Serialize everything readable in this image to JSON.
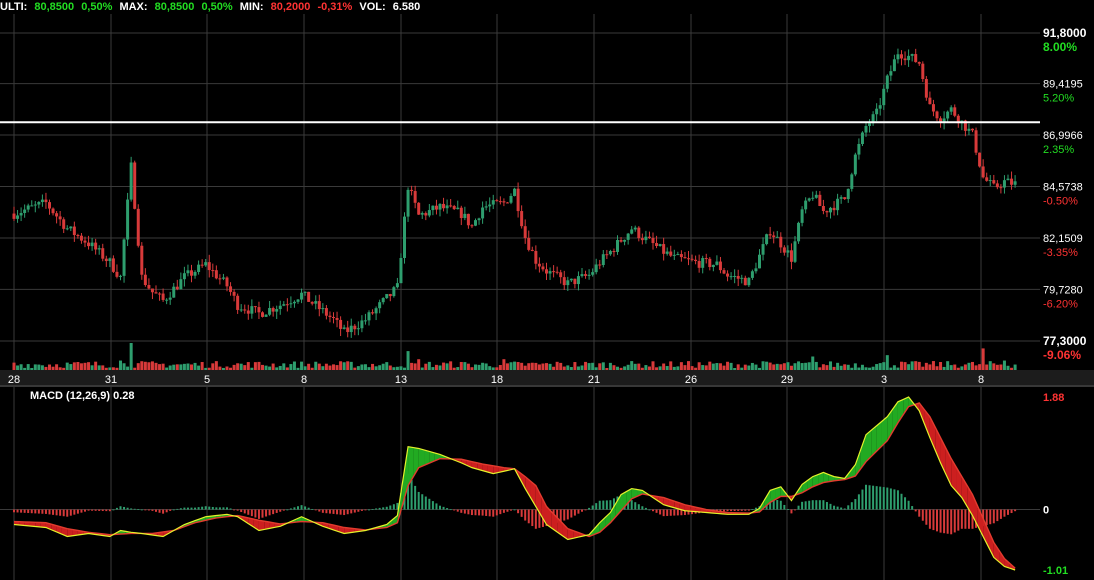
{
  "header": {
    "ulti_label": "ULTI:",
    "ulti_value": "80,8500",
    "ulti_pct": "0,50%",
    "max_label": "MAX:",
    "max_value": "80,8500",
    "max_pct": "0,50%",
    "min_label": "MIN:",
    "min_value": "80,2000",
    "min_pct": "-0,31%",
    "vol_label": "VOL:",
    "vol_value": "6.580"
  },
  "colors": {
    "up": "#2e9e6e",
    "down": "#d83a3a",
    "pos_text": "#22dd22",
    "neg_text": "#ff3333",
    "grid": "#3a3a3a",
    "background": "#000000"
  },
  "chart_data": [
    {
      "type": "candlestick",
      "panel": "price",
      "ylim": [
        77.3,
        91.8
      ],
      "price_ticks": [
        {
          "label": "91,8000",
          "value": 91.8
        },
        {
          "label": "89,4195",
          "value": 89.4195
        },
        {
          "label": "86,9966",
          "value": 86.9966
        },
        {
          "label": "84,5738",
          "value": 84.5738
        },
        {
          "label": "82,1509",
          "value": 82.1509
        },
        {
          "label": "79,7280",
          "value": 79.728
        },
        {
          "label": "77,3000",
          "value": 77.3
        }
      ],
      "pct_ticks": [
        {
          "label": "8.00%",
          "value": 91.8,
          "sign": "pos",
          "bold": true
        },
        {
          "label": "5.20%",
          "value": 89.4195,
          "sign": "pos"
        },
        {
          "label": "2.35%",
          "value": 86.9966,
          "sign": "pos"
        },
        {
          "label": "-0.50%",
          "value": 84.5738,
          "sign": "neg"
        },
        {
          "label": "-3.35%",
          "value": 82.1509,
          "sign": "neg"
        },
        {
          "label": "-6.20%",
          "value": 79.728,
          "sign": "neg"
        },
        {
          "label": "-9.06%",
          "value": 77.3,
          "sign": "neg",
          "bold": true
        }
      ],
      "horizontal_line": 87.6,
      "x_labels": [
        "28",
        "31",
        "5",
        "8",
        "13",
        "18",
        "21",
        "26",
        "29",
        "3",
        "8"
      ],
      "close_path": [
        [
          0,
          83.3
        ],
        [
          3,
          83.8
        ],
        [
          5,
          82.6
        ],
        [
          7,
          81.9
        ],
        [
          9,
          81.0
        ],
        [
          10,
          80.3
        ],
        [
          11,
          85.5
        ],
        [
          12,
          80.3
        ],
        [
          13,
          79.6
        ],
        [
          14,
          79.2
        ],
        [
          16,
          80.3
        ],
        [
          18,
          80.9
        ],
        [
          20,
          79.9
        ],
        [
          21,
          79.0
        ],
        [
          23,
          78.6
        ],
        [
          25,
          79.0
        ],
        [
          27,
          79.5
        ],
        [
          28,
          79.1
        ],
        [
          30,
          78.3
        ],
        [
          31,
          77.7
        ],
        [
          33,
          78.3
        ],
        [
          35,
          79.3
        ],
        [
          36,
          79.8
        ],
        [
          37,
          84.6
        ],
        [
          38,
          83.2
        ],
        [
          40,
          83.6
        ],
        [
          42,
          83.3
        ],
        [
          43,
          82.7
        ],
        [
          44,
          83.6
        ],
        [
          46,
          83.8
        ],
        [
          47,
          84.4
        ],
        [
          48,
          82.2
        ],
        [
          49,
          81.1
        ],
        [
          50,
          80.6
        ],
        [
          52,
          80.0
        ],
        [
          54,
          80.4
        ],
        [
          55,
          81.0
        ],
        [
          56,
          81.5
        ],
        [
          58,
          82.6
        ],
        [
          59,
          82.2
        ],
        [
          61,
          81.5
        ],
        [
          62,
          81.2
        ],
        [
          64,
          81.0
        ],
        [
          66,
          80.9
        ],
        [
          67,
          80.4
        ],
        [
          69,
          80.1
        ],
        [
          70,
          81.3
        ],
        [
          71,
          82.5
        ],
        [
          72,
          81.9
        ],
        [
          73,
          81.2
        ],
        [
          74,
          83.4
        ],
        [
          75,
          84.2
        ],
        [
          76,
          83.4
        ],
        [
          77,
          83.7
        ],
        [
          78,
          84.0
        ],
        [
          79,
          86.0
        ],
        [
          80,
          87.4
        ],
        [
          81,
          88.0
        ],
        [
          82,
          89.6
        ],
        [
          83,
          90.9
        ],
        [
          84,
          90.7
        ],
        [
          85,
          90.4
        ],
        [
          86,
          88.3
        ],
        [
          87,
          87.8
        ],
        [
          88,
          88.2
        ],
        [
          89,
          87.6
        ],
        [
          90,
          87.0
        ],
        [
          91,
          85.0
        ],
        [
          92,
          84.5
        ],
        [
          93,
          84.8
        ],
        [
          94,
          84.7
        ]
      ],
      "candles_per_day": 3,
      "volume_spikes": [
        [
          11,
          1.0
        ],
        [
          10,
          0.35
        ],
        [
          37,
          0.7
        ],
        [
          38,
          0.4
        ],
        [
          46,
          0.4
        ],
        [
          75,
          0.5
        ],
        [
          82,
          0.55
        ],
        [
          85,
          0.3
        ],
        [
          91,
          0.8
        ],
        [
          93,
          0.35
        ]
      ]
    },
    {
      "type": "macd",
      "title": "MACD (12,26,9) 0.28",
      "ylim": [
        -1.01,
        1.88
      ],
      "tick_labels": [
        {
          "label": "1.88",
          "value": 1.88,
          "sign": "neg"
        },
        {
          "label": "0",
          "value": 0,
          "sign": "neutral"
        },
        {
          "label": "-1.01",
          "value": -1.01,
          "sign": "pos"
        }
      ],
      "macd_line": [
        [
          0,
          -0.25
        ],
        [
          3,
          -0.3
        ],
        [
          5,
          -0.45
        ],
        [
          7,
          -0.4
        ],
        [
          9,
          -0.45
        ],
        [
          10,
          -0.35
        ],
        [
          11,
          -0.38
        ],
        [
          12,
          -0.4
        ],
        [
          14,
          -0.45
        ],
        [
          16,
          -0.25
        ],
        [
          18,
          -0.12
        ],
        [
          20,
          -0.08
        ],
        [
          21,
          -0.12
        ],
        [
          23,
          -0.35
        ],
        [
          25,
          -0.28
        ],
        [
          27,
          -0.12
        ],
        [
          29,
          -0.28
        ],
        [
          31,
          -0.4
        ],
        [
          33,
          -0.35
        ],
        [
          35,
          -0.25
        ],
        [
          36,
          -0.1
        ],
        [
          37,
          1.05
        ],
        [
          38,
          1.02
        ],
        [
          40,
          0.92
        ],
        [
          42,
          0.78
        ],
        [
          43,
          0.7
        ],
        [
          45,
          0.6
        ],
        [
          47,
          0.68
        ],
        [
          48,
          0.35
        ],
        [
          49,
          0.05
        ],
        [
          50,
          -0.25
        ],
        [
          52,
          -0.5
        ],
        [
          54,
          -0.42
        ],
        [
          55,
          -0.22
        ],
        [
          56,
          -0.05
        ],
        [
          57,
          0.25
        ],
        [
          58,
          0.35
        ],
        [
          59,
          0.32
        ],
        [
          61,
          0.08
        ],
        [
          63,
          -0.02
        ],
        [
          65,
          -0.05
        ],
        [
          67,
          -0.08
        ],
        [
          69,
          -0.08
        ],
        [
          70,
          0.02
        ],
        [
          71,
          0.32
        ],
        [
          72,
          0.38
        ],
        [
          73,
          0.15
        ],
        [
          74,
          0.42
        ],
        [
          75,
          0.55
        ],
        [
          76,
          0.62
        ],
        [
          77,
          0.55
        ],
        [
          78,
          0.52
        ],
        [
          79,
          0.75
        ],
        [
          80,
          1.25
        ],
        [
          82,
          1.55
        ],
        [
          83,
          1.8
        ],
        [
          84,
          1.88
        ],
        [
          85,
          1.65
        ],
        [
          86,
          1.2
        ],
        [
          87,
          0.78
        ],
        [
          88,
          0.4
        ],
        [
          89,
          0.2
        ],
        [
          90,
          -0.1
        ],
        [
          91,
          -0.45
        ],
        [
          92,
          -0.8
        ],
        [
          93,
          -0.95
        ],
        [
          94,
          -1.01
        ]
      ],
      "signal_line": [
        [
          0,
          -0.2
        ],
        [
          3,
          -0.22
        ],
        [
          5,
          -0.32
        ],
        [
          7,
          -0.38
        ],
        [
          9,
          -0.42
        ],
        [
          11,
          -0.4
        ],
        [
          13,
          -0.4
        ],
        [
          15,
          -0.35
        ],
        [
          17,
          -0.22
        ],
        [
          19,
          -0.14
        ],
        [
          21,
          -0.1
        ],
        [
          23,
          -0.18
        ],
        [
          25,
          -0.24
        ],
        [
          27,
          -0.2
        ],
        [
          29,
          -0.22
        ],
        [
          31,
          -0.3
        ],
        [
          33,
          -0.34
        ],
        [
          35,
          -0.3
        ],
        [
          36,
          -0.22
        ],
        [
          37,
          0.4
        ],
        [
          38,
          0.7
        ],
        [
          40,
          0.85
        ],
        [
          42,
          0.84
        ],
        [
          44,
          0.76
        ],
        [
          46,
          0.7
        ],
        [
          47,
          0.68
        ],
        [
          48,
          0.55
        ],
        [
          49,
          0.4
        ],
        [
          50,
          0.05
        ],
        [
          52,
          -0.32
        ],
        [
          54,
          -0.45
        ],
        [
          55,
          -0.38
        ],
        [
          56,
          -0.22
        ],
        [
          57,
          -0.02
        ],
        [
          58,
          0.18
        ],
        [
          59,
          0.26
        ],
        [
          61,
          0.2
        ],
        [
          63,
          0.08
        ],
        [
          65,
          0.0
        ],
        [
          67,
          -0.05
        ],
        [
          69,
          -0.06
        ],
        [
          70,
          -0.04
        ],
        [
          71,
          0.12
        ],
        [
          72,
          0.22
        ],
        [
          73,
          0.22
        ],
        [
          74,
          0.28
        ],
        [
          75,
          0.38
        ],
        [
          76,
          0.45
        ],
        [
          77,
          0.48
        ],
        [
          78,
          0.5
        ],
        [
          79,
          0.56
        ],
        [
          80,
          0.8
        ],
        [
          82,
          1.15
        ],
        [
          83,
          1.45
        ],
        [
          84,
          1.72
        ],
        [
          85,
          1.78
        ],
        [
          86,
          1.55
        ],
        [
          87,
          1.2
        ],
        [
          88,
          0.85
        ],
        [
          89,
          0.55
        ],
        [
          90,
          0.25
        ],
        [
          91,
          -0.15
        ],
        [
          92,
          -0.55
        ],
        [
          93,
          -0.82
        ],
        [
          94,
          -0.98
        ]
      ]
    }
  ]
}
